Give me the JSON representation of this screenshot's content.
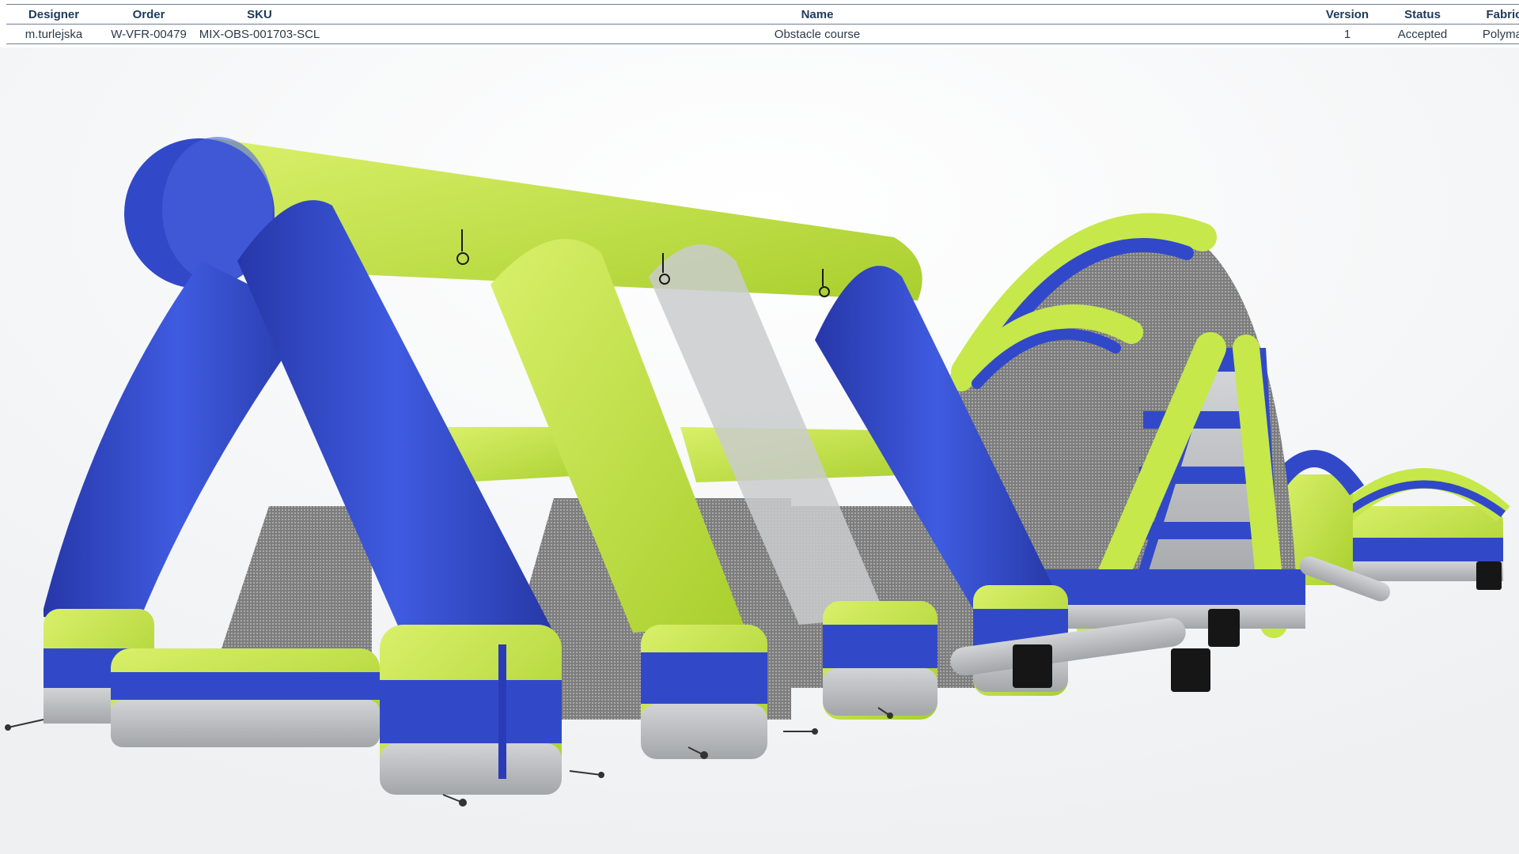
{
  "table": {
    "headers": [
      "Designer",
      "Order",
      "SKU",
      "Name",
      "Version",
      "Status",
      "Fabric"
    ],
    "row": [
      "m.turlejska",
      "W-VFR-00479",
      "MIX-OBS-001703-SCL",
      "Obstacle course",
      "1",
      "Accepted",
      "Polymat"
    ]
  },
  "colors": {
    "lime": "#c6e84a",
    "blue": "#3149c9",
    "gray": "#b9bcbf",
    "mesh": "#8c8c8c",
    "blower": "#161616"
  },
  "image": {
    "subject": "inflatable-obstacle-course-render",
    "icons": [
      "blower-unit-icon",
      "anchor-stake-icon",
      "hanging-ring-icon"
    ]
  }
}
